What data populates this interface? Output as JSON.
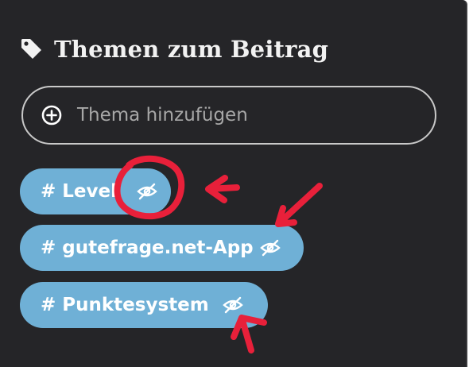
{
  "panel": {
    "title": "Themen zum Beitrag",
    "title_icon": "tag-icon",
    "add_topic": {
      "placeholder": "Thema hinzufügen",
      "icon": "plus-circle-icon"
    },
    "topics": [
      {
        "label": "# Level",
        "action_icon": "eye-off-icon"
      },
      {
        "label": "# gutefrage.net-App",
        "action_icon": "eye-off-icon"
      },
      {
        "label": "# Punktesystem",
        "action_icon": "eye-off-icon"
      }
    ]
  },
  "colors": {
    "panel_background": "#252528",
    "chip_background": "#6fb0d6",
    "annotation": "#e8203a"
  }
}
